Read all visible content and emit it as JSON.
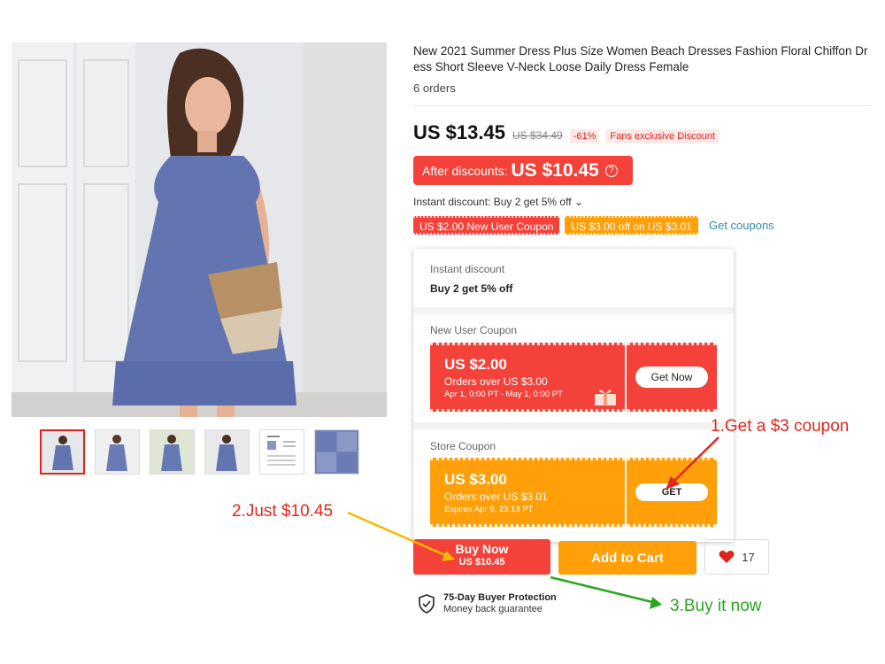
{
  "product": {
    "title": "New 2021 Summer Dress Plus Size Women Beach Dresses Fashion Floral Chiffon Dress Short Sleeve V-Neck Loose Daily Dress Female",
    "orders": "6 orders"
  },
  "price": {
    "current": "US $13.45",
    "original": "US $34.49",
    "discount_pct": "-61%",
    "fans_badge": "Fans exclusive Discount",
    "after_label": "After discounts:",
    "after_value": "US $10.45",
    "info_icon": "?"
  },
  "instant_discount_line": "Instant discount: Buy 2 get 5% off ⌄",
  "coupon_tags": {
    "new_user": "US $2.00 New User Coupon",
    "store": "US $3.00 off on US $3.01",
    "get_coupons": "Get coupons"
  },
  "popup": {
    "instant_label": "Instant discount",
    "instant_value": "Buy 2 get 5% off",
    "new_user_label": "New User Coupon",
    "new_user_coupon": {
      "amount": "US $2.00",
      "condition": "Orders over US $3.00",
      "dates": "Apr 1, 0:00 PT - May 1, 0:00 PT",
      "button": "Get Now"
    },
    "store_label": "Store Coupon",
    "store_coupon": {
      "amount": "US $3.00",
      "condition": "Orders over US $3.01",
      "dates": "Expires Apr 9, 23:13 PT",
      "button": "GET"
    }
  },
  "actions": {
    "buy_now": "Buy Now",
    "buy_now_price": "US $10.45",
    "add_to_cart": "Add to Cart",
    "wishlist_count": "17"
  },
  "protection": {
    "title": "75-Day Buyer Protection",
    "subtitle": "Money back guarantee"
  },
  "annotations": {
    "step1": "1.Get a $3 coupon",
    "step2": "2.Just $10.45",
    "step3": "3.Buy it now"
  },
  "colors": {
    "accent_red": "#f4423a",
    "accent_orange": "#ff9f0a",
    "link_blue": "#2a8ea8",
    "annotation_red": "#e0281f",
    "annotation_green": "#2aa61f",
    "annotation_yellow": "#f5b800"
  }
}
